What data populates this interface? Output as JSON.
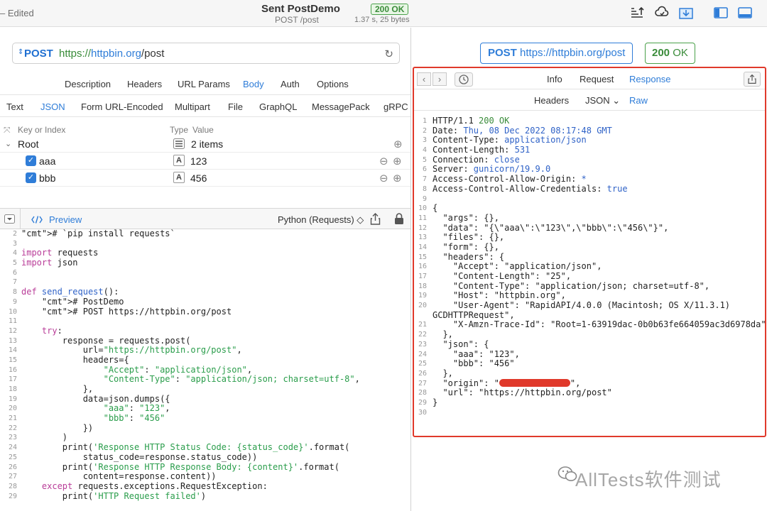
{
  "titlebar": {
    "edited": "– Edited",
    "title": "Sent PostDemo",
    "subtitle": "POST /post",
    "status": "200 OK",
    "timing": "1.37 s, 25 bytes"
  },
  "request": {
    "method": "POST",
    "url_scheme": "https://",
    "url_host": "httpbin.org",
    "url_path": "/post"
  },
  "tabs": [
    "Description",
    "Headers",
    "URL Params",
    "Body",
    "Auth",
    "Options"
  ],
  "active_tab": "Body",
  "body_formats": [
    "Text",
    "JSON",
    "Form URL-Encoded",
    "Multipart",
    "File",
    "GraphQL",
    "MessagePack",
    "gRPC"
  ],
  "active_body_format": "JSON",
  "kv_table": {
    "col_key": "Key or Index",
    "col_type": "Type",
    "col_value": "Value",
    "root_label": "Root",
    "root_value": "2 items",
    "rows": [
      {
        "key": "aaa",
        "type": "A",
        "value": "123"
      },
      {
        "key": "bbb",
        "type": "A",
        "value": "456"
      }
    ]
  },
  "code_panel": {
    "preview_label": "Preview",
    "language": "Python (Requests) ◇"
  },
  "code_line_numbers": [
    "2",
    "3",
    "4",
    "5",
    "6",
    "7",
    "8",
    "9",
    "10",
    "11",
    "12",
    "13",
    "14",
    "15",
    "16",
    "17",
    "18",
    "19",
    "20",
    "21",
    "22",
    "23",
    "24",
    "25",
    "26",
    "27",
    "28",
    "29"
  ],
  "code_lines": [
    "# `pip install requests`",
    "",
    "import requests",
    "import json",
    "",
    "",
    "def send_request():",
    "    # PostDemo",
    "    # POST https://httpbin.org/post",
    "",
    "    try:",
    "        response = requests.post(",
    "            url=\"https://httpbin.org/post\",",
    "            headers={",
    "                \"Accept\": \"application/json\",",
    "                \"Content-Type\": \"application/json; charset=utf-8\",",
    "            },",
    "            data=json.dumps({",
    "                \"aaa\": \"123\",",
    "                \"bbb\": \"456\"",
    "            })",
    "        )",
    "        print('Response HTTP Status Code: {status_code}'.format(",
    "            status_code=response.status_code))",
    "        print('Response HTTP Response Body: {content}'.format(",
    "            content=response.content))",
    "    except requests.exceptions.RequestException:",
    "        print('HTTP Request failed')"
  ],
  "response_pane": {
    "url_method": "POST",
    "url": "https://httpbin.org/post",
    "status_code": "200",
    "status_text": "OK",
    "tabs": [
      "Info",
      "Request",
      "Response"
    ],
    "active_tab": "Response",
    "subtabs": [
      "Headers",
      "JSON ⌄",
      "Raw"
    ],
    "active_subtab": "Raw"
  },
  "response_line_numbers": [
    "1",
    "2",
    "3",
    "4",
    "5",
    "6",
    "7",
    "8",
    "9",
    "10",
    "11",
    "12",
    "13",
    "14",
    "15",
    "16",
    "17",
    "18",
    "19",
    "20",
    "",
    "21",
    "22",
    "23",
    "24",
    "25",
    "26",
    "27",
    "28",
    "29",
    "30"
  ],
  "response_lines": [
    [
      "HTTP/1.1 ",
      "200 OK"
    ],
    [
      "Date: ",
      "Thu, 08 Dec 2022 08:17:48 GMT"
    ],
    [
      "Content-Type: ",
      "application/json"
    ],
    [
      "Content-Length: ",
      "531"
    ],
    [
      "Connection: ",
      "close"
    ],
    [
      "Server: ",
      "gunicorn/19.9.0"
    ],
    [
      "Access-Control-Allow-Origin: ",
      "*"
    ],
    [
      "Access-Control-Allow-Credentials: ",
      "true"
    ],
    [
      "",
      ""
    ],
    [
      "{",
      ""
    ],
    [
      "  \"args\": {},",
      ""
    ],
    [
      "  \"data\": \"{\\\"aaa\\\":\\\"123\\\",\\\"bbb\\\":\\\"456\\\"}\",",
      ""
    ],
    [
      "  \"files\": {},",
      ""
    ],
    [
      "  \"form\": {},",
      ""
    ],
    [
      "  \"headers\": {",
      ""
    ],
    [
      "    \"Accept\": \"application/json\",",
      ""
    ],
    [
      "    \"Content-Length\": \"25\",",
      ""
    ],
    [
      "    \"Content-Type\": \"application/json; charset=utf-8\",",
      ""
    ],
    [
      "    \"Host\": \"httpbin.org\",",
      ""
    ],
    [
      "    \"User-Agent\": \"RapidAPI/4.0.0 (Macintosh; OS X/11.3.1)",
      ""
    ],
    [
      "GCDHTTPRequest\",",
      ""
    ],
    [
      "    \"X-Amzn-Trace-Id\": \"Root=1-63919dac-0b0b63fe664059ac3d6978da\"",
      ""
    ],
    [
      "  },",
      ""
    ],
    [
      "  \"json\": {",
      ""
    ],
    [
      "    \"aaa\": \"123\",",
      ""
    ],
    [
      "    \"bbb\": \"456\"",
      ""
    ],
    [
      "  },",
      ""
    ],
    [
      "  \"origin\": \"",
      "REDACTED"
    ],
    [
      "  \"url\": \"https://httpbin.org/post\"",
      ""
    ],
    [
      "}",
      ""
    ],
    [
      "",
      ""
    ]
  ],
  "watermark": "AllTests软件测试"
}
